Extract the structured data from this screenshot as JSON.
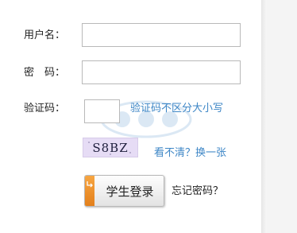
{
  "form": {
    "username_label": "用户名：",
    "password_label": "密　码：",
    "captcha_label": "验证码：",
    "username_value": "",
    "password_value": "",
    "captcha_value": "",
    "captcha_hint": "验证码不区分大小写",
    "captcha_image_text": "S8BZ",
    "refresh_link": "看不清？换一张",
    "login_button": "学生登录",
    "forgot_link": "忘记密码？"
  },
  "colors": {
    "link": "#3d86c6",
    "button_accent": "#f39a33",
    "captcha_bg": "#e6dcf5"
  },
  "icons": {
    "login_button_icon": "arrow-icon"
  }
}
